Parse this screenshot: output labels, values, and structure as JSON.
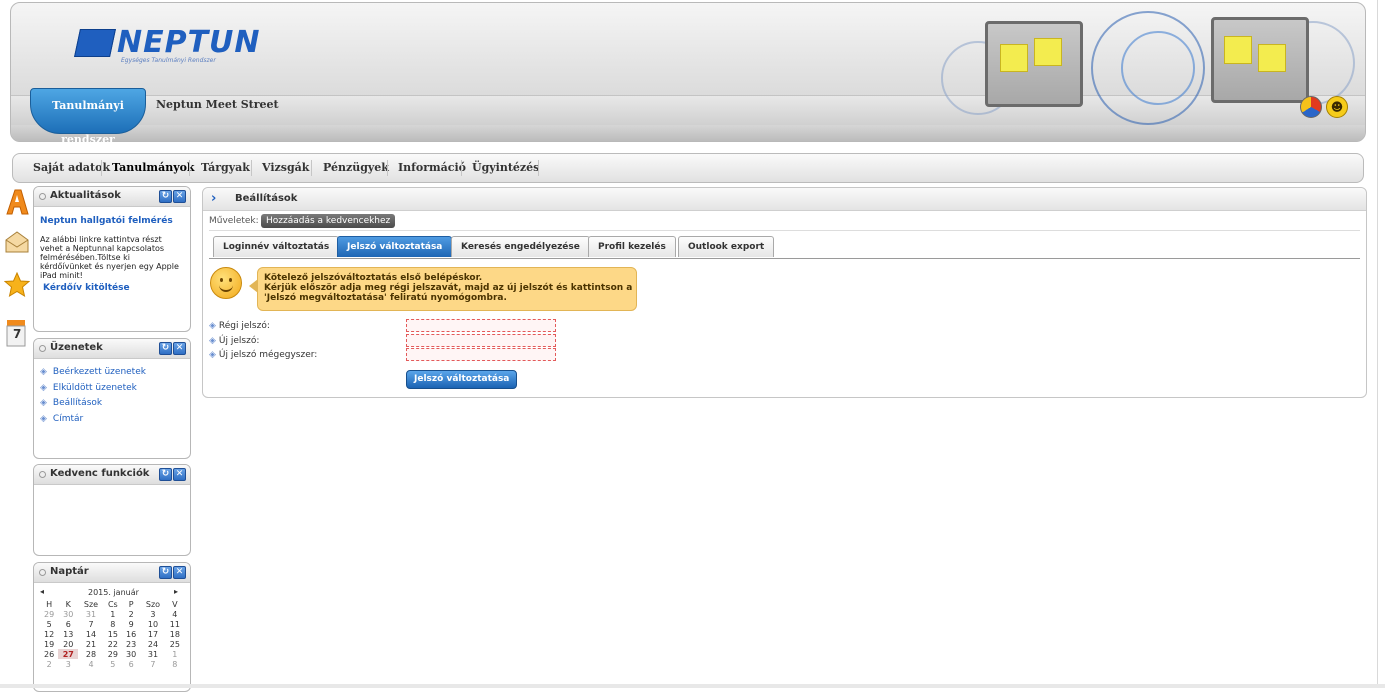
{
  "header": {
    "logo_text": "NEPTUN",
    "logo_subtitle": "Egységes Tanulmányi Rendszer",
    "system_tab": "Tanulmányi rendszer",
    "site_title": "Neptun Meet Street"
  },
  "menu": {
    "items": [
      "Saját adatok",
      "Tanulmányok",
      "Tárgyak",
      "Vizsgák",
      "Pénzügyek",
      "Információ",
      "Ügyintézés"
    ]
  },
  "left_icons": {
    "calendar_day": "7"
  },
  "boxes": {
    "news": {
      "title": "Aktualitások",
      "headline": "Neptun hallgatói felmérés",
      "body": "Az alábbi linkre kattintva részt vehet a Neptunnal kapcsolatos felmérésében.Töltse ki kérdőívünket és nyerjen egy Apple iPad minit!",
      "link": "Kérdőív kitöltése"
    },
    "messages": {
      "title": "Üzenetek",
      "items": [
        "Beérkezett üzenetek",
        "Elküldött üzenetek",
        "Beállítások",
        "Címtár"
      ]
    },
    "favorites": {
      "title": "Kedvenc funkciók"
    },
    "calendar": {
      "title": "Naptár",
      "month": "2015. január",
      "prev": "◂",
      "next": "▸",
      "weekdays": [
        "H",
        "K",
        "Sze",
        "Cs",
        "P",
        "Szo",
        "V"
      ],
      "weeks": [
        [
          "29",
          "30",
          "31",
          "1",
          "2",
          "3",
          "4"
        ],
        [
          "5",
          "6",
          "7",
          "8",
          "9",
          "10",
          "11"
        ],
        [
          "12",
          "13",
          "14",
          "15",
          "16",
          "17",
          "18"
        ],
        [
          "19",
          "20",
          "21",
          "22",
          "23",
          "24",
          "25"
        ],
        [
          "26",
          "27",
          "28",
          "29",
          "30",
          "31",
          "1"
        ],
        [
          "2",
          "3",
          "4",
          "5",
          "6",
          "7",
          "8"
        ]
      ],
      "today": "27"
    }
  },
  "main": {
    "title": "Beállítások",
    "ops_label": "Műveletek:",
    "fav_button": "Hozzáadás a kedvencekhez",
    "tabs": [
      "Loginnév változtatás",
      "Jelszó változtatása",
      "Keresés engedélyezése",
      "Profil kezelés",
      "Outlook export"
    ],
    "active_tab": "Jelszó változtatása",
    "notice_line1": "Kötelező jelszóváltoztatás első belépéskor.",
    "notice_line2": "Kérjük először adja meg régi jelszavát, majd az új jelszót és kattintson a",
    "notice_line3": "'Jelszó megváltoztatása' feliratú nyomógombra.",
    "fields": [
      "Régi jelszó:",
      "Új jelszó:",
      "Új jelszó mégegyszer:"
    ],
    "submit": "Jelszó változtatása"
  },
  "colors": {
    "accent_blue": "#1f66b4",
    "notice_bg": "#fdd887",
    "invalid_border": "#e35a5a"
  }
}
